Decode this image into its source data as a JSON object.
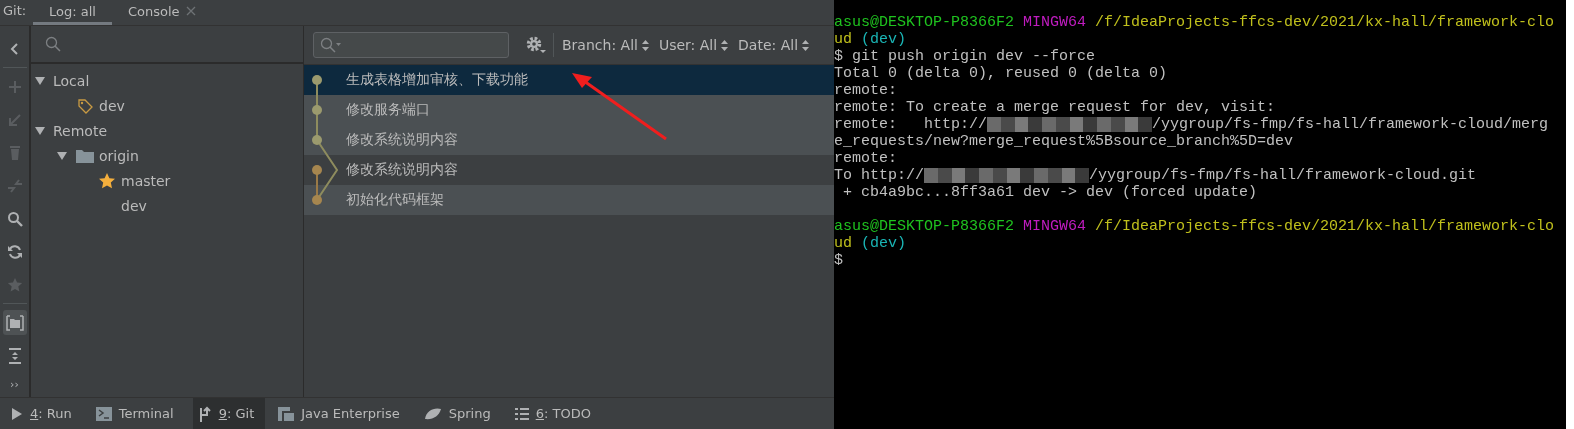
{
  "tool_window": {
    "label": "Git:",
    "tabs": [
      {
        "label": "Log: all",
        "selected": true,
        "closable": false
      },
      {
        "label": "Console",
        "selected": false,
        "closable": true
      }
    ]
  },
  "side_toolbar": [
    {
      "kind": "collapse",
      "disabled": false,
      "selected": false
    },
    {
      "kind": "add",
      "disabled": true,
      "selected": false
    },
    {
      "kind": "checkout",
      "disabled": true,
      "selected": false
    },
    {
      "kind": "delete",
      "disabled": true,
      "selected": false
    },
    {
      "kind": "compare",
      "disabled": true,
      "selected": false
    },
    {
      "kind": "search",
      "disabled": false,
      "selected": false
    },
    {
      "kind": "refresh",
      "disabled": false,
      "selected": false
    },
    {
      "kind": "favorite",
      "disabled": true,
      "selected": false
    },
    {
      "kind": "group",
      "disabled": false,
      "selected": true
    },
    {
      "kind": "expand",
      "disabled": false,
      "selected": false
    },
    {
      "kind": "more",
      "label": "››",
      "disabled": false,
      "selected": false
    }
  ],
  "branches": [
    {
      "label": "Local",
      "expanded": true,
      "children": [
        {
          "label": "dev",
          "kind": "tag"
        }
      ]
    },
    {
      "label": "Remote",
      "expanded": true,
      "children": [
        {
          "label": "origin",
          "kind": "folder",
          "expanded": true,
          "children": [
            {
              "label": "master",
              "kind": "star"
            },
            {
              "label": "dev",
              "kind": "plain"
            }
          ]
        }
      ]
    }
  ],
  "log_toolbar": {
    "filters": [
      {
        "label": "Branch: All"
      },
      {
        "label": "User: All"
      },
      {
        "label": "Date: All"
      }
    ]
  },
  "commits": [
    {
      "message": "生成表格增加审核、下载功能",
      "selected": true,
      "highlighted": false,
      "color": "#9b9a6e"
    },
    {
      "message": "修改服务端口",
      "selected": false,
      "highlighted": true,
      "color": "#9b9a6e"
    },
    {
      "message": "修改系统说明内容",
      "selected": false,
      "highlighted": true,
      "color": "#9b9a6e"
    },
    {
      "message": "修改系统说明内容",
      "selected": false,
      "highlighted": false,
      "color": "#a6864f"
    },
    {
      "message": "初始化代码框架",
      "selected": false,
      "highlighted": true,
      "color": "#a6864f"
    }
  ],
  "bottom_tabs": [
    {
      "kind": "run",
      "number": "4",
      "label": ": Run",
      "selected": false
    },
    {
      "kind": "terminal",
      "label": "Terminal",
      "selected": false
    },
    {
      "kind": "git",
      "number": "9",
      "label": ": Git",
      "selected": true
    },
    {
      "kind": "enterprise",
      "label": "Java Enterprise",
      "selected": false
    },
    {
      "kind": "spring",
      "label": "Spring",
      "selected": false
    },
    {
      "kind": "todo",
      "number": "6",
      "label": ": TODO",
      "selected": false
    }
  ],
  "terminal": {
    "lines": [
      {
        "segments": [
          {
            "kind": "user",
            "text": "asus@DESKTOP-P8366F2"
          },
          {
            "kind": "shell",
            "text": " MINGW64"
          },
          {
            "kind": "path",
            "text": " /f/IdeaProjects-ffcs-dev/2021/kx-hall/framework-clo"
          }
        ]
      },
      {
        "segments": [
          {
            "kind": "path",
            "text": "ud"
          },
          {
            "kind": "branch",
            "text": " (dev)"
          }
        ]
      },
      {
        "segments": [
          {
            "kind": "plain",
            "text": "$ git push origin dev --force"
          }
        ]
      },
      {
        "segments": [
          {
            "kind": "plain",
            "text": "Total 0 (delta 0), reused 0 (delta 0)"
          }
        ]
      },
      {
        "segments": [
          {
            "kind": "plain",
            "text": "remote:"
          }
        ]
      },
      {
        "segments": [
          {
            "kind": "plain",
            "text": "remote: To create a merge request for dev, visit:"
          }
        ]
      },
      {
        "segments": [
          {
            "kind": "plain",
            "text": "remote:   http://"
          },
          {
            "kind": "redacted"
          },
          {
            "kind": "plain",
            "text": "/yygroup/fs-fmp/fs-hall/framework-cloud/merg"
          }
        ]
      },
      {
        "segments": [
          {
            "kind": "plain",
            "text": "e_requests/new?merge_request%5Bsource_branch%5D=dev"
          }
        ]
      },
      {
        "segments": [
          {
            "kind": "plain",
            "text": "remote:"
          }
        ]
      },
      {
        "segments": [
          {
            "kind": "plain",
            "text": "To http://"
          },
          {
            "kind": "redacted"
          },
          {
            "kind": "plain",
            "text": "/yygroup/fs-fmp/fs-hall/framework-cloud.git"
          }
        ]
      },
      {
        "segments": [
          {
            "kind": "plain",
            "text": " + cb4a9bc...8ff3a61 dev -> dev (forced update)"
          }
        ]
      },
      {
        "kind": "blank"
      },
      {
        "segments": [
          {
            "kind": "user",
            "text": "asus@DESKTOP-P8366F2"
          },
          {
            "kind": "shell",
            "text": " MINGW64"
          },
          {
            "kind": "path",
            "text": " /f/IdeaProjects-ffcs-dev/2021/kx-hall/framework-clo"
          }
        ]
      },
      {
        "segments": [
          {
            "kind": "path",
            "text": "ud"
          },
          {
            "kind": "branch",
            "text": " (dev)"
          }
        ]
      },
      {
        "segments": [
          {
            "kind": "plain",
            "text": "$"
          }
        ]
      }
    ]
  }
}
